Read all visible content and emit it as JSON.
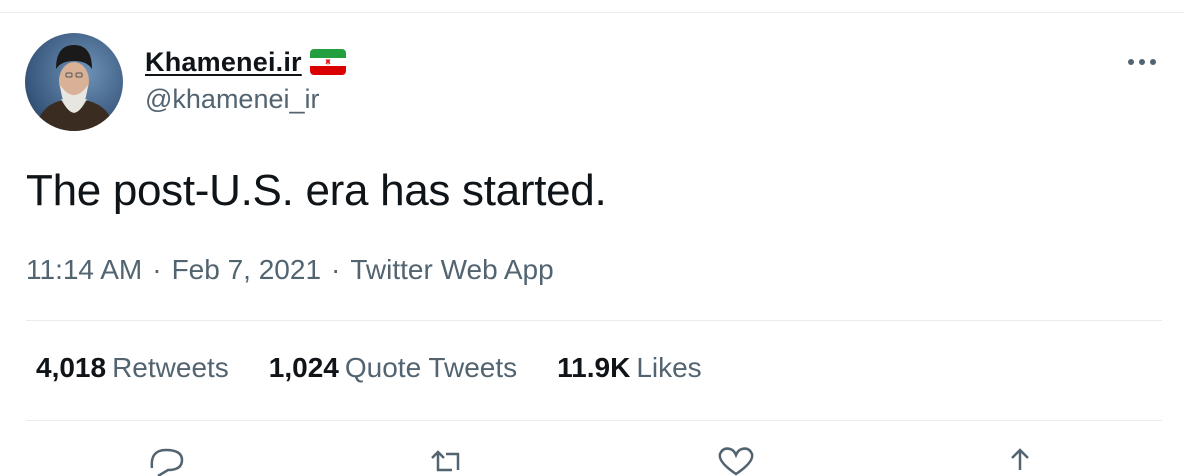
{
  "tweet": {
    "display_name": "Khamenei.ir",
    "handle": "@khamenei_ir",
    "text": "The post-U.S. era has started.",
    "time": "11:14 AM",
    "date": "Feb 7, 2021",
    "source": "Twitter Web App",
    "separator": "·"
  },
  "stats": {
    "retweets_count": "4,018",
    "retweets_label": "Retweets",
    "quotes_count": "1,024",
    "quotes_label": "Quote Tweets",
    "likes_count": "11.9K",
    "likes_label": "Likes"
  },
  "icons": {
    "flag": "iran-flag-icon",
    "more": "more-options-icon",
    "reply": "reply-icon",
    "retweet": "retweet-icon",
    "like": "like-icon",
    "share": "share-icon"
  },
  "colors": {
    "text_primary": "#0f1419",
    "text_secondary": "#536471",
    "divider": "#e6ecf0",
    "flag_green": "#239f40",
    "flag_red": "#da0000"
  }
}
